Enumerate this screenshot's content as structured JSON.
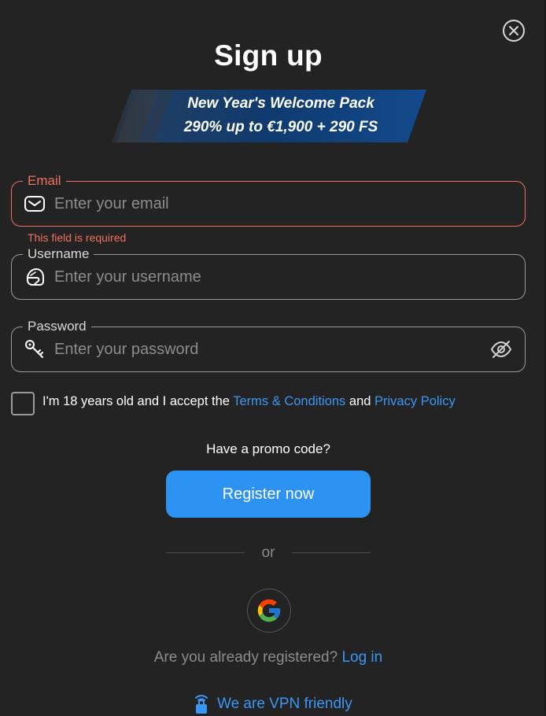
{
  "header": {
    "title": "Sign up",
    "close_icon": "close-icon"
  },
  "banner": {
    "line1": "New Year's Welcome Pack",
    "line2": "290% up to €1,900 + 290 FS",
    "color": "#0f3a6e"
  },
  "form": {
    "email": {
      "label": "Email",
      "placeholder": "Enter your email",
      "value": "",
      "icon": "envelope-icon",
      "error": "This field is required"
    },
    "username": {
      "label": "Username",
      "placeholder": "Enter your username",
      "value": "",
      "icon": "helmet-icon"
    },
    "password": {
      "label": "Password",
      "placeholder": "Enter your password",
      "value": "",
      "icon": "key-icon",
      "toggle_icon": "eye-off-icon"
    },
    "consent": {
      "prefix": "I'm 18 years old and I accept the ",
      "terms_link": "Terms & Conditions",
      "middle": " and ",
      "privacy_link": "Privacy Policy",
      "checked": false
    }
  },
  "promo": {
    "label": "Have a promo code?"
  },
  "actions": {
    "register_label": "Register now",
    "or_label": "or",
    "google_icon": "google-icon"
  },
  "footer": {
    "already_text": "Are you already registered?",
    "login_link": "Log in",
    "vpn_text": "We are VPN friendly",
    "vpn_icon": "vpn-lock-icon"
  },
  "colors": {
    "background": "#232323",
    "accent": "#2d93f3",
    "link": "#3a97f5",
    "error": "#f0705e"
  }
}
